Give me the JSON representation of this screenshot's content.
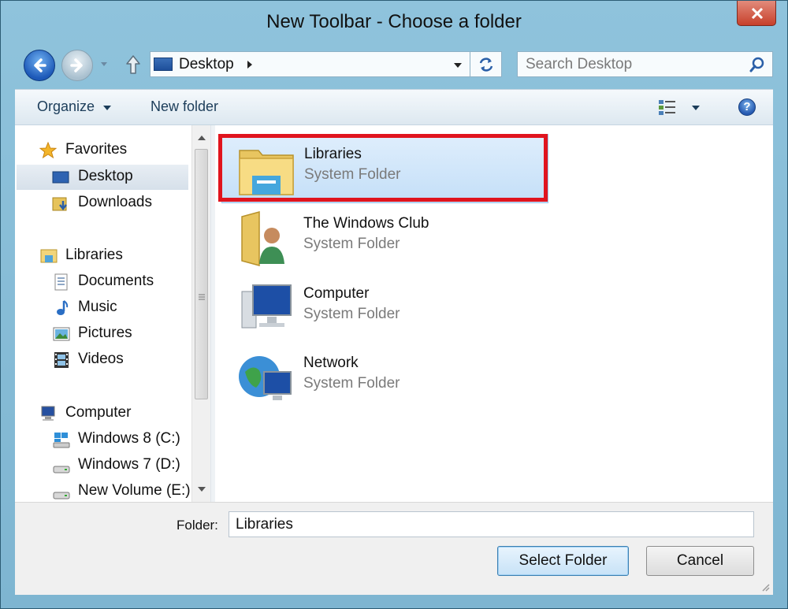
{
  "window": {
    "title": "New Toolbar - Choose a folder"
  },
  "navigation": {
    "address": {
      "location": "Desktop"
    },
    "search": {
      "placeholder": "Search Desktop"
    }
  },
  "commandbar": {
    "organize_label": "Organize",
    "new_folder_label": "New folder"
  },
  "sidebar": {
    "favorites": {
      "label": "Favorites",
      "items": [
        "Desktop",
        "Downloads"
      ]
    },
    "libraries": {
      "label": "Libraries",
      "items": [
        "Documents",
        "Music",
        "Pictures",
        "Videos"
      ]
    },
    "computer": {
      "label": "Computer",
      "items": [
        "Windows 8 (C:)",
        "Windows 7 (D:)",
        "New Volume (E:)"
      ]
    },
    "selected": "Desktop"
  },
  "files": [
    {
      "name": "Libraries",
      "type": "System Folder",
      "icon": "libraries-folder-icon",
      "selected": true
    },
    {
      "name": "The Windows Club",
      "type": "System Folder",
      "icon": "user-folder-icon"
    },
    {
      "name": "Computer",
      "type": "System Folder",
      "icon": "computer-icon"
    },
    {
      "name": "Network",
      "type": "System Folder",
      "icon": "network-icon"
    }
  ],
  "footer": {
    "folder_label": "Folder:",
    "folder_value": "Libraries",
    "select_button": "Select Folder",
    "cancel_button": "Cancel"
  },
  "colors": {
    "highlight": "#e0141e",
    "titlebar": "#8fc3dc",
    "close": "#c7402b",
    "selection": "#c4dff8"
  }
}
